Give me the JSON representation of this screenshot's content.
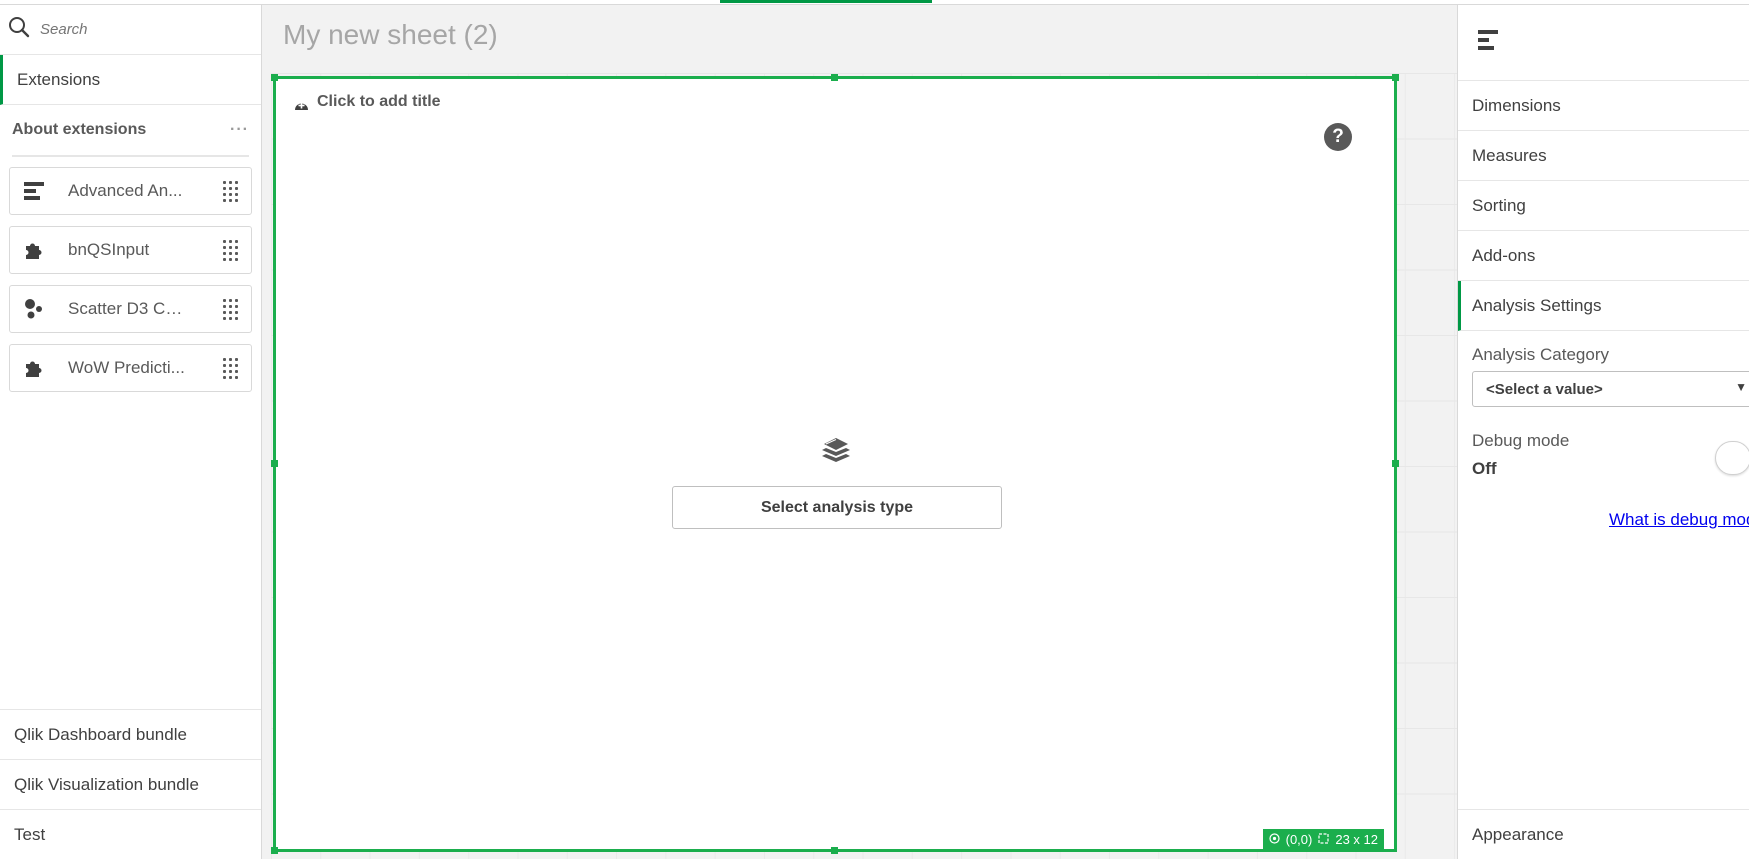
{
  "search": {
    "placeholder": "Search"
  },
  "left_panel": {
    "active_tab": "Extensions",
    "section_title": "About extensions",
    "section_more": "···",
    "extensions": [
      {
        "label": "Advanced An...",
        "icon": "bar-list-icon"
      },
      {
        "label": "bnQSInput",
        "icon": "puzzle-icon"
      },
      {
        "label": "Scatter D3 Ch...",
        "icon": "scatter-icon"
      },
      {
        "label": "WoW Predicti...",
        "icon": "puzzle-icon"
      }
    ],
    "bundles": [
      "Qlik Dashboard bundle",
      "Qlik Visualization bundle",
      "Test"
    ]
  },
  "sheet": {
    "title": "My new sheet (2)",
    "card_title": "Click to add title",
    "help": "?",
    "select_button": "Select analysis type",
    "status_position": "(0,0)",
    "status_size": "23 x 12"
  },
  "right_panel": {
    "sections": [
      "Dimensions",
      "Measures",
      "Sorting",
      "Add-ons",
      "Analysis Settings"
    ],
    "analysis_category_label": "Analysis Category",
    "analysis_category_value": "<Select a value>",
    "debug_label": "Debug mode",
    "debug_value": "Off",
    "debug_link": "What is debug mode?",
    "appearance": "Appearance"
  },
  "colors": {
    "accent": "#009845",
    "selection": "#1bae4d",
    "link": "#0000ee"
  }
}
